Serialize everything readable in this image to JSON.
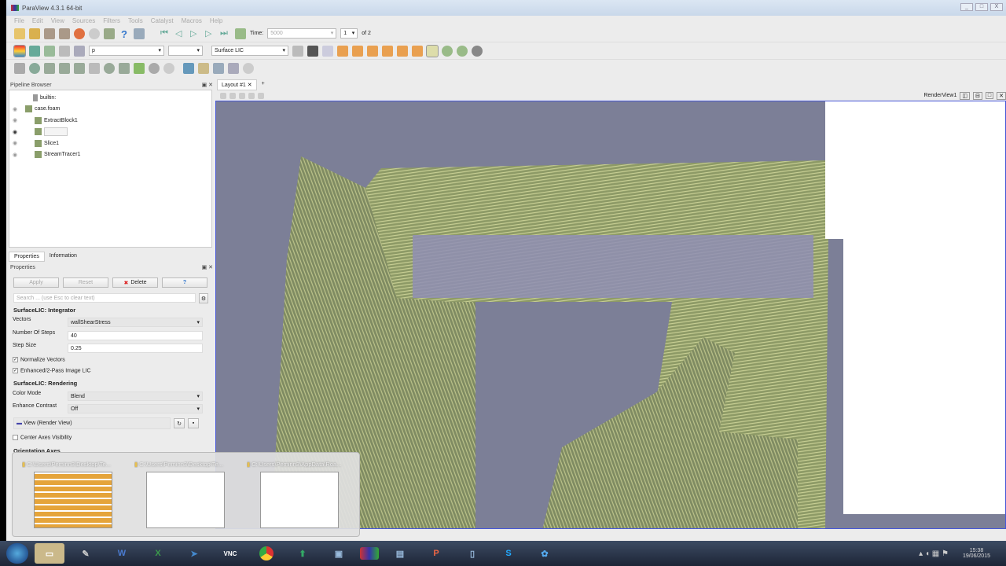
{
  "window": {
    "title": "ParaView 4.3.1 64-bit",
    "controls": [
      "_",
      "□",
      "X"
    ]
  },
  "menu": [
    "File",
    "Edit",
    "View",
    "Sources",
    "Filters",
    "Tools",
    "Catalyst",
    "Macros",
    "Help"
  ],
  "toolbar": {
    "time_label": "Time:",
    "time_value": "5000",
    "timestep": "1",
    "of_label": "of 2",
    "array_select": "p",
    "representation": "Surface LIC"
  },
  "pipeline": {
    "title": "Pipeline Browser",
    "items": [
      {
        "label": "builtin:"
      },
      {
        "label": "case.foam"
      },
      {
        "label": "ExtractBlock1"
      },
      {
        "label": ""
      },
      {
        "label": "Slice1"
      },
      {
        "label": "StreamTracer1"
      }
    ]
  },
  "tabs": [
    "Properties",
    "Information"
  ],
  "properties": {
    "title": "Properties",
    "apply": "Apply",
    "reset": "Reset",
    "delete": "Delete",
    "help": "?",
    "search_placeholder": "Search ... (use Esc to clear text)",
    "integrator_header": "SurfaceLIC: Integrator",
    "vectors_label": "Vectors",
    "vectors_value": "wallShearStress",
    "steps_label": "Number Of Steps",
    "steps_value": "40",
    "stepsize_label": "Step Size",
    "stepsize_value": "0.25",
    "normalize": "Normalize Vectors",
    "enhanced": "Enhanced/2-Pass Image LIC",
    "rendering_header": "SurfaceLIC: Rendering",
    "colormode_label": "Color Mode",
    "colormode_value": "Blend",
    "contrast_label": "Enhance Contrast",
    "contrast_value": "Off",
    "view_label": "View (Render View)",
    "center_axes": "Center Axes Visibility",
    "orientation_header": "Orientation Axes"
  },
  "layout": {
    "tab": "Layout #1",
    "add": "+",
    "view_name": "RenderView1"
  },
  "popup": {
    "items": [
      "C:\\Users\\Peminn3\\Desktop\\Te...",
      "C:\\Users\\Peminn3\\Desktop\\Te...",
      "C:\\Users\\Peminn3\\AppData\\Roa..."
    ]
  },
  "taskbar": {
    "time": "15:38",
    "date": "19/06/2015"
  }
}
